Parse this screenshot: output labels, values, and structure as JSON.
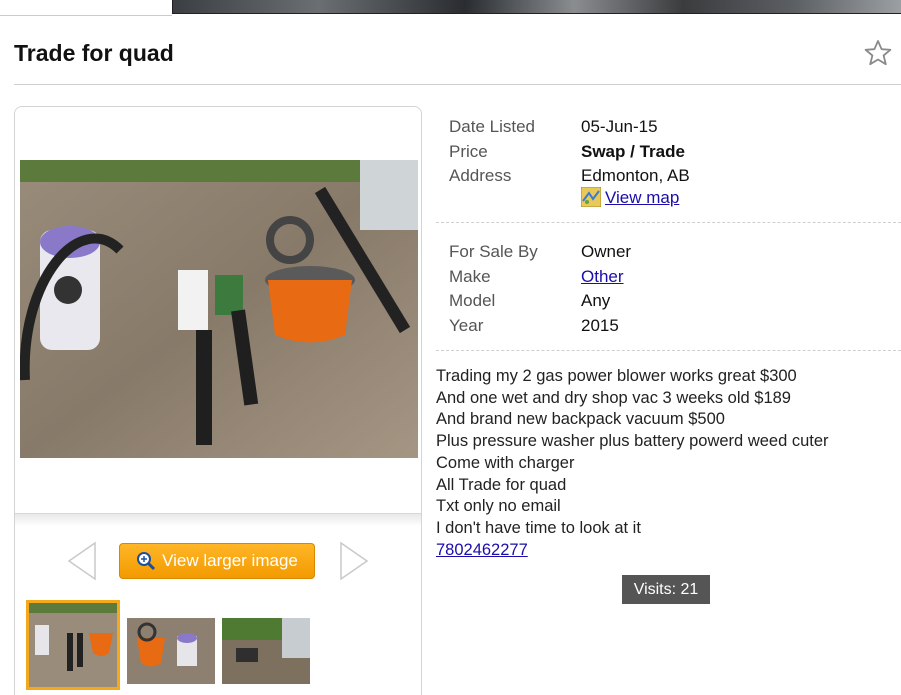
{
  "listing": {
    "title": "Trade for quad",
    "details_primary": [
      {
        "label": "Date Listed",
        "value": "05-Jun-15"
      },
      {
        "label": "Price",
        "value": "Swap / Trade"
      },
      {
        "label": "Address",
        "value": "Edmonton, AB"
      }
    ],
    "view_map_label": "View map",
    "details_secondary": [
      {
        "label": "For Sale By",
        "value": "Owner"
      },
      {
        "label": "Make",
        "value": "Other"
      },
      {
        "label": "Model",
        "value": "Any"
      },
      {
        "label": "Year",
        "value": "2015"
      }
    ],
    "description_lines": [
      "Trading my 2 gas power blower works great $300",
      "And one wet and dry shop vac 3 weeks old $189",
      "And brand new backpack vacuum $500",
      "Plus pressure washer plus battery powerd weed cuter",
      "Come with charger",
      "All Trade for quad",
      "Txt only no email",
      "I don't have time to look at it"
    ],
    "phone": "7802462277",
    "visits": "Visits: 21"
  },
  "gallery": {
    "view_larger_label": "View larger image",
    "thumbnail_count": 3,
    "selected_index": 0
  },
  "icons": {
    "star": "star-outline-icon",
    "prev": "chevron-left-icon",
    "next": "chevron-right-icon",
    "magnify": "magnifier-icon",
    "map": "map-icon"
  },
  "colors": {
    "accent_orange": "#f39a00",
    "link_blue": "#1a0dab",
    "visits_bg": "#555555",
    "thumb_selected": "#f4a81c"
  }
}
